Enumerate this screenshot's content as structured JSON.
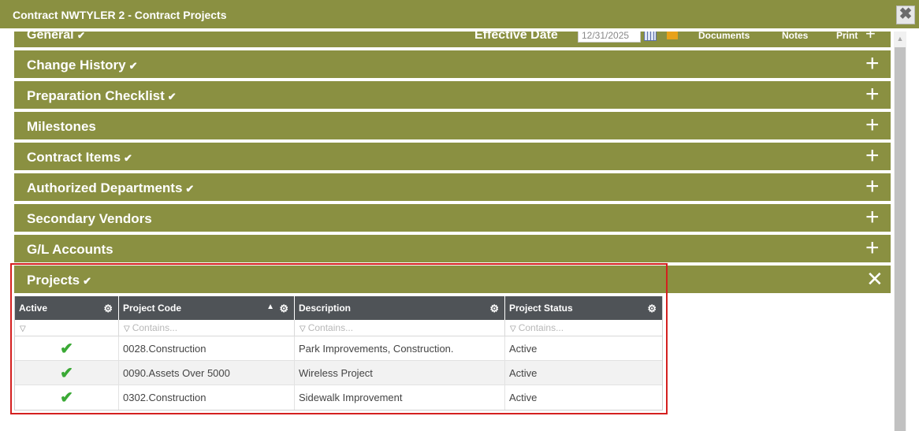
{
  "window": {
    "title": "Contract NWTYLER 2 - Contract Projects",
    "close_symbol": "✖"
  },
  "strip": {
    "general_label": "General",
    "check": "✔",
    "effective_date_label": "Effective Date",
    "effective_date_value": "12/31/2025",
    "documents_label": "Documents",
    "notes_label": "Notes",
    "print_label": "Print"
  },
  "sections": [
    {
      "label": "Change History",
      "check": "✔",
      "toggle": "+"
    },
    {
      "label": "Preparation Checklist",
      "check": "✔",
      "toggle": "+"
    },
    {
      "label": "Milestones",
      "check": "",
      "toggle": "+"
    },
    {
      "label": "Contract Items",
      "check": "✔",
      "toggle": "+"
    },
    {
      "label": "Authorized Departments",
      "check": "✔",
      "toggle": "+"
    },
    {
      "label": "Secondary Vendors",
      "check": "",
      "toggle": "+"
    },
    {
      "label": "G/L Accounts",
      "check": "",
      "toggle": "+"
    },
    {
      "label": "Projects",
      "check": "✔",
      "toggle": "✕"
    }
  ],
  "grid": {
    "columns": [
      "Active",
      "Project Code",
      "Description",
      "Project Status"
    ],
    "filter_placeholder": "Contains...",
    "gear_symbol": "⚙",
    "sort_symbol": "▲",
    "funnel_symbol": "▽",
    "active_symbol": "✔",
    "rows": [
      {
        "code": "0028.Construction",
        "description": "Park Improvements, Construction.",
        "status": "Active"
      },
      {
        "code": "0090.Assets Over 5000",
        "description": "Wireless Project",
        "status": "Active"
      },
      {
        "code": "0302.Construction",
        "description": "Sidewalk Improvement",
        "status": "Active"
      }
    ]
  },
  "colors": {
    "section_bg": "#8a9041",
    "grid_header_bg": "#4f5357",
    "highlight_border": "#d4201f",
    "check_green": "#3aa935"
  }
}
